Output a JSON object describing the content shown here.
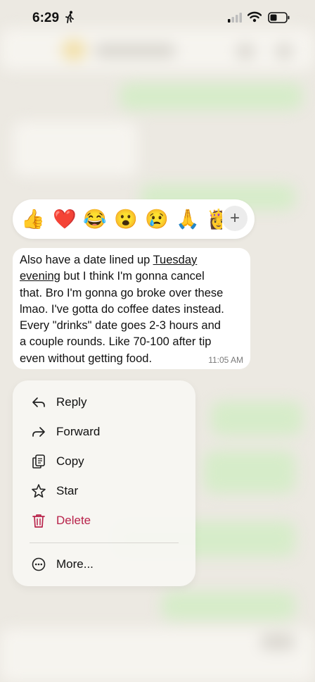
{
  "status_bar": {
    "time": "6:29",
    "activity_icon": "running-figure-icon",
    "signal_icon": "cellular-signal-icon",
    "wifi_icon": "wifi-icon",
    "battery_icon": "battery-icon"
  },
  "reactions": {
    "items": [
      {
        "emoji": "👍",
        "name": "thumbs-up"
      },
      {
        "emoji": "❤️",
        "name": "red-heart"
      },
      {
        "emoji": "😂",
        "name": "face-with-tears-of-joy"
      },
      {
        "emoji": "😮",
        "name": "face-with-open-mouth"
      },
      {
        "emoji": "😢",
        "name": "crying-face"
      },
      {
        "emoji": "🙏",
        "name": "folded-hands"
      },
      {
        "emoji": "👸",
        "name": "partially-visible-emoji"
      }
    ],
    "more_icon": "plus-icon",
    "more_label": "+"
  },
  "message": {
    "line1_pre": "Also have a date lined up ",
    "link_day": "Tuesday",
    "link_time": "evening",
    "line2_post": " but I think I'm gonna cancel",
    "rest": "that. Bro I'm gonna go broke over these\nlmao. I've gotta do coffee dates instead.\nEvery \"drinks\" date goes 2-3 hours and\na couple rounds. Like 70-100 after tip\neven without getting food.",
    "timestamp": "11:05 AM"
  },
  "menu": {
    "reply": "Reply",
    "forward": "Forward",
    "copy": "Copy",
    "star": "Star",
    "delete": "Delete",
    "more": "More..."
  },
  "colors": {
    "accent_delete": "#b8224a",
    "bubble_bg": "#ffffff",
    "chat_bg": "#ece9e2",
    "outgoing_bg": "#d6ecc9"
  }
}
